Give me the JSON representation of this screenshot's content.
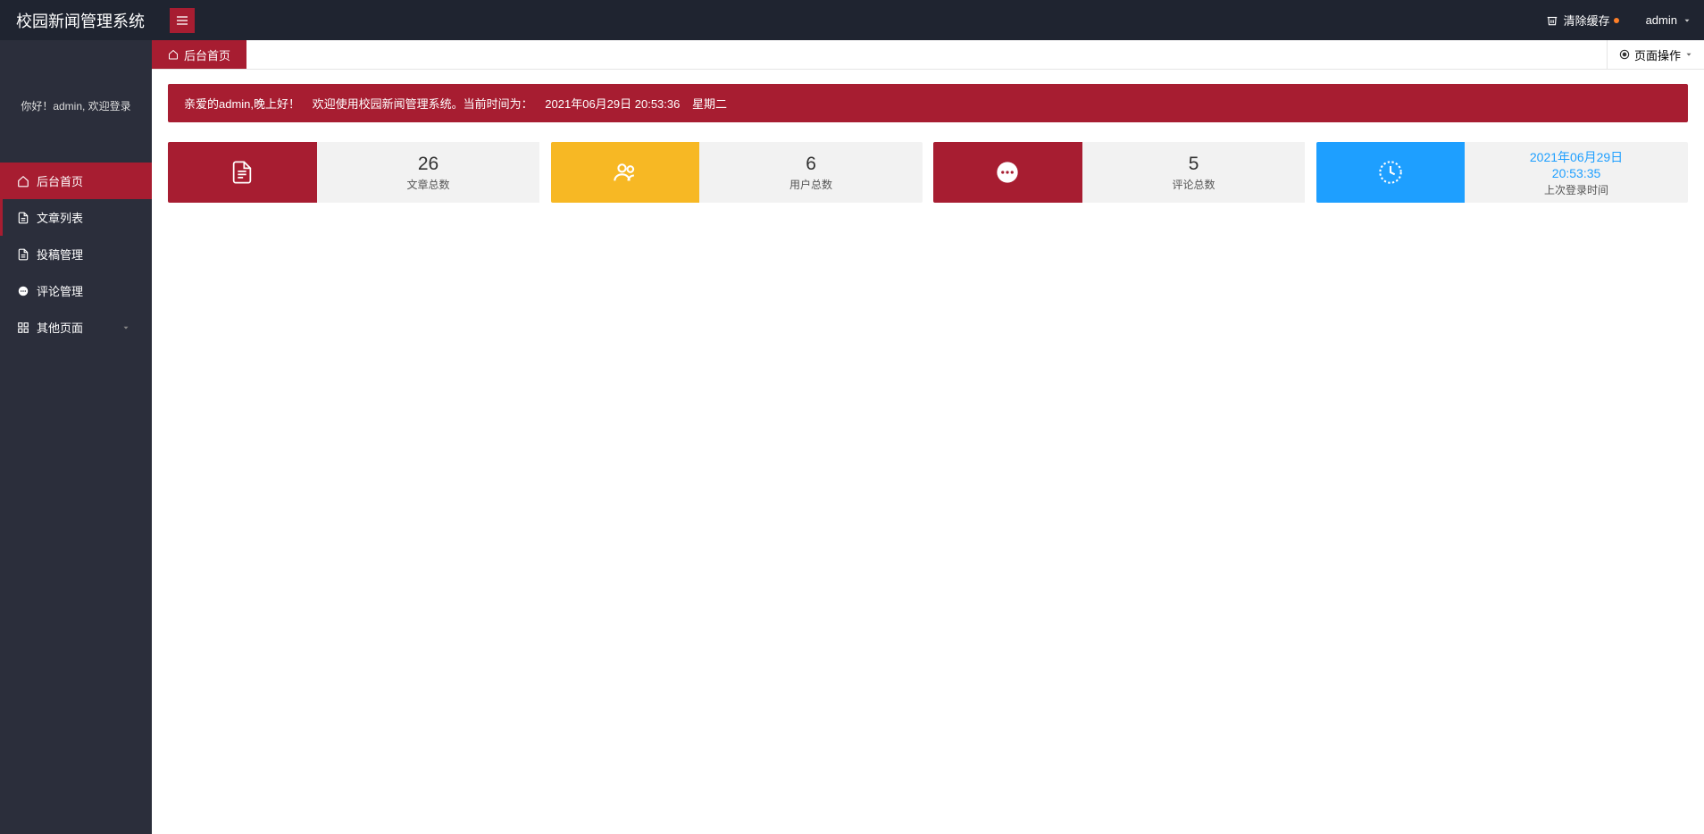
{
  "header": {
    "app_title": "校园新闻管理系统",
    "clear_cache_label": "清除缓存",
    "user_label": "admin"
  },
  "sidebar": {
    "welcome": "你好！admin, 欢迎登录",
    "items": [
      {
        "label": "后台首页",
        "icon": "home",
        "active": true
      },
      {
        "label": "文章列表",
        "icon": "document",
        "highlight": true
      },
      {
        "label": "投稿管理",
        "icon": "document"
      },
      {
        "label": "评论管理",
        "icon": "comment"
      },
      {
        "label": "其他页面",
        "icon": "grid",
        "chevron": true
      }
    ]
  },
  "tabs": {
    "home_tab": "后台首页",
    "page_ops_label": "页面操作"
  },
  "greeting": {
    "text1": "亲爱的admin,晚上好！",
    "text2": "欢迎使用校园新闻管理系统。当前时间为：",
    "datetime": "2021年06月29日 20:53:36",
    "weekday": "星期二"
  },
  "stats": {
    "articles": {
      "value": "26",
      "label": "文章总数"
    },
    "users": {
      "value": "6",
      "label": "用户总数"
    },
    "comments": {
      "value": "5",
      "label": "评论总数"
    },
    "last_login": {
      "date": "2021年06月29日",
      "time": "20:53:35",
      "label": "上次登录时间"
    }
  }
}
